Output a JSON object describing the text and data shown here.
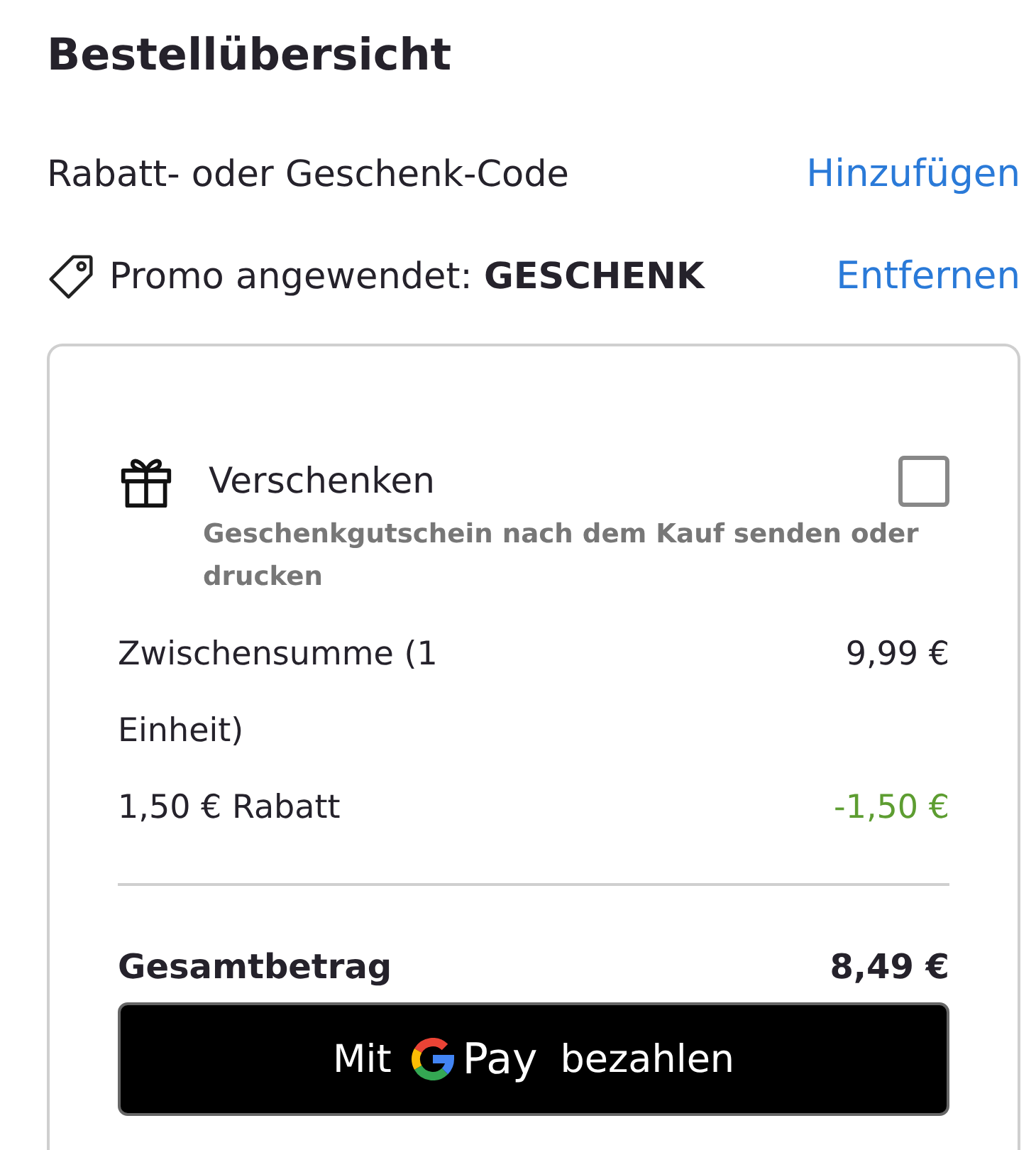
{
  "title": "Bestellübersicht",
  "code_row": {
    "label": "Rabatt- oder Geschenk-Code",
    "action": "Hinzufügen"
  },
  "promo": {
    "label": "Promo angewendet: **GESCHENK**",
    "action": "Entfernen"
  },
  "gift": {
    "label": "Verschenken",
    "checked": false,
    "description": "Geschenkgutschein nach dem Kauf senden oder drucken"
  },
  "lines": [
    {
      "kind": "normal",
      "label": "Zwischensumme (1 Einheit)",
      "amount": "9,99 €"
    },
    {
      "kind": "discount",
      "label": "1,50 € Rabatt",
      "amount": "-1,50 €"
    }
  ],
  "total": {
    "label": "Gesamtbetrag",
    "amount": "8,49 €"
  },
  "pay_button": {
    "prefix": "Mit",
    "brand": "Pay",
    "suffix": "bezahlen"
  }
}
